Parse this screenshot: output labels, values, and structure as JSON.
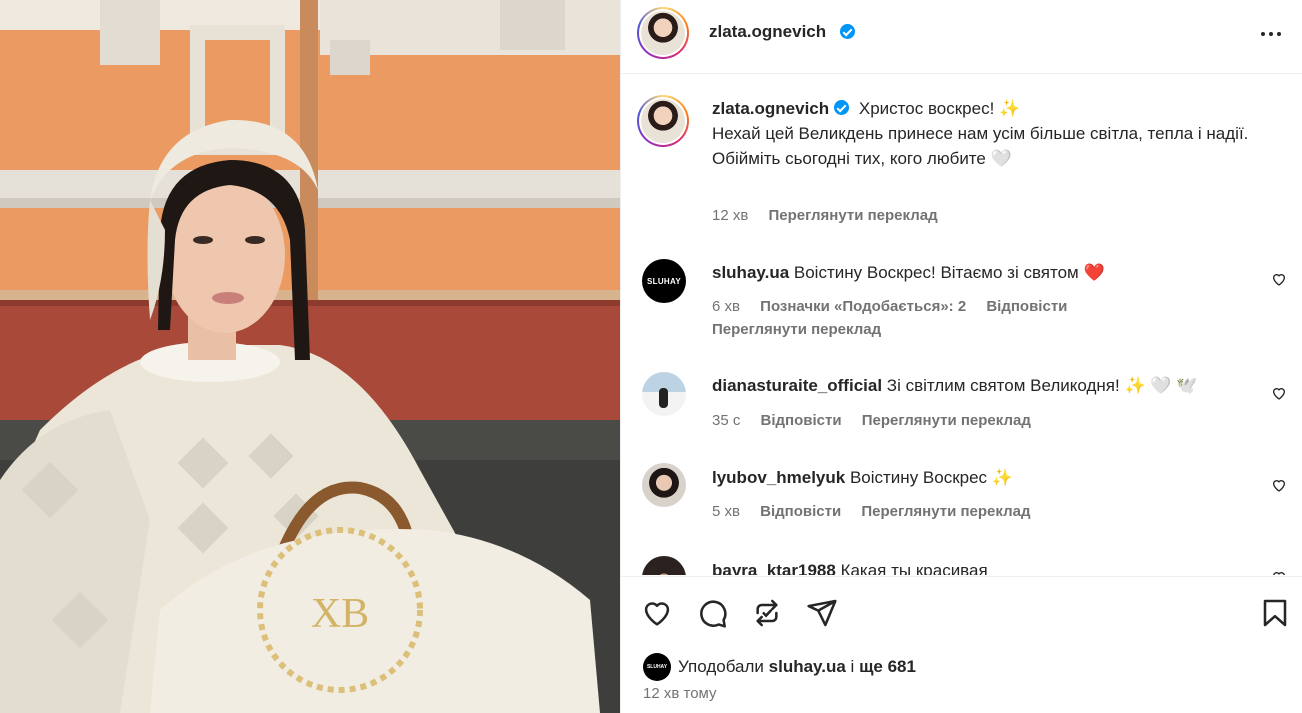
{
  "post": {
    "author": "zlata.ognevich",
    "caption_line1": "Христос воскрес! ✨",
    "caption_line2": "Нехай цей Великдень принесе нам усім більше світла, тепла і надії.",
    "caption_line3": "Обійміть сьогодні тих, кого любите 🤍",
    "caption_time": "12 хв",
    "caption_translate": "Переглянути переклад"
  },
  "photo": {
    "embroidery_monogram": "ХВ"
  },
  "comments": [
    {
      "user": "sluhay.ua",
      "avatar_text": "SLUHAY",
      "text": "Воістину Воскрес! Вітаємо зі святом",
      "emoji": "❤️",
      "time": "6 хв",
      "likes": "Позначки «Подобається»: 2",
      "reply": "Відповісти",
      "translate": "Переглянути переклад"
    },
    {
      "user": "dianasturaite_official",
      "text": "Зі світлим святом Великодня!",
      "emoji": "✨ 🤍 🕊️",
      "time": "35 с",
      "reply": "Відповісти",
      "translate": "Переглянути переклад"
    },
    {
      "user": "lyubov_hmelyuk",
      "text": "Воістину Воскрес",
      "emoji": "✨",
      "time": "5 хв",
      "reply": "Відповісти",
      "translate": "Переглянути переклад"
    },
    {
      "user": "bayra_ktar1988",
      "text": "Какая ты красивая"
    }
  ],
  "footer": {
    "liked_prefix": "Уподобали",
    "liked_user": "sluhay.ua",
    "liked_mid": "і",
    "liked_count": "ще 681",
    "mini_avatar_text": "SLUHAY",
    "time_ago": "12 хв тому"
  },
  "icons": {
    "like": "heart-icon",
    "comment": "comment-icon",
    "repost": "repost-icon",
    "share": "send-icon",
    "save": "bookmark-icon",
    "more": "more-horizontal-icon"
  },
  "colors": {
    "verified": "#0095f6",
    "muted": "#737373",
    "text": "#262626",
    "wall": "#e8955c"
  }
}
